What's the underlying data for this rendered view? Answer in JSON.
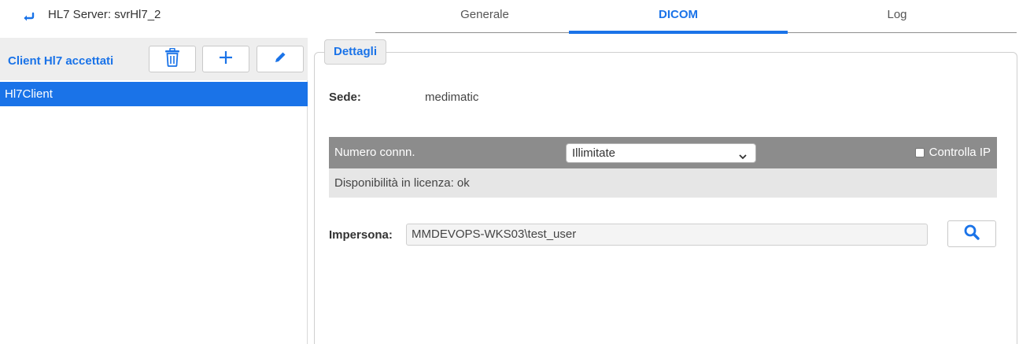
{
  "header": {
    "server_title": "HL7 Server: svrHl7_2",
    "back_icon": "back-arrow-icon"
  },
  "tabs": [
    {
      "label": "Generale",
      "active": false
    },
    {
      "label": "DICOM",
      "active": true
    },
    {
      "label": "Log",
      "active": false
    }
  ],
  "left_panel": {
    "title": "Client Hl7 accettati",
    "buttons": [
      {
        "icon": "trash-icon"
      },
      {
        "icon": "plus-icon"
      },
      {
        "icon": "pencil-icon"
      }
    ],
    "items": [
      {
        "label": "Hl7Client",
        "selected": true
      }
    ]
  },
  "details": {
    "legend": "Dettagli",
    "sede_label": "Sede:",
    "sede_value": "medimatic",
    "conn_label": "Numero connn.",
    "conn_value": "Illimitate",
    "controlla_ip_label": "Controlla IP",
    "controlla_ip_checked": false,
    "disponibilita": "Disponibilità in licenza: ok",
    "impersona_label": "Impersona:",
    "impersona_value": "MMDEVOPS-WKS03\\test_user",
    "search_icon": "search-icon"
  },
  "colors": {
    "accent": "#1a73e8",
    "conn_row_bg": "#8c8c8c",
    "disp_row_bg": "#e6e6e6"
  }
}
